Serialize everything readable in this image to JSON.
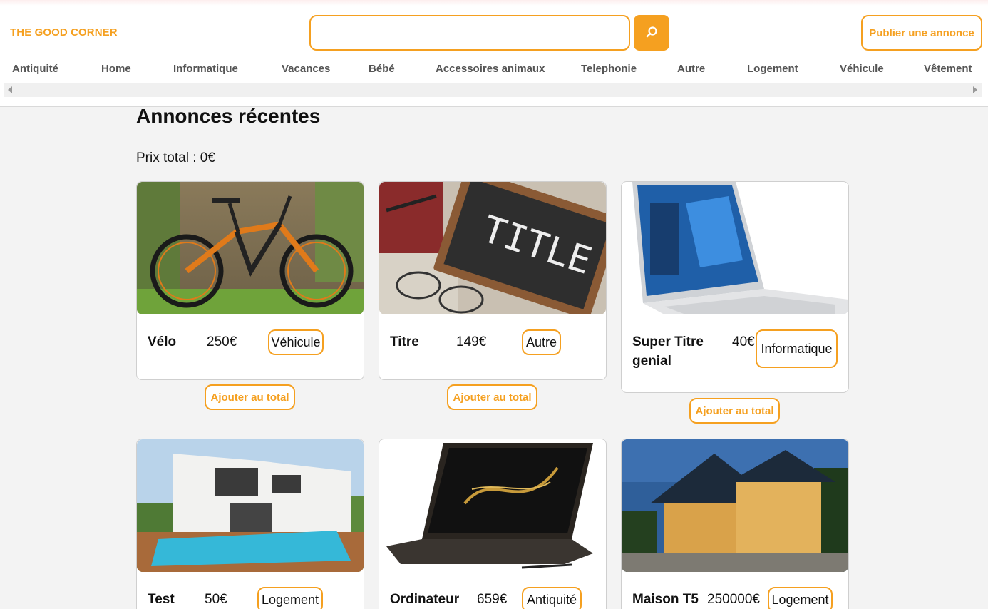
{
  "header": {
    "logo": "THE GOOD CORNER",
    "search_value": "",
    "search_placeholder": "",
    "publish_label": "Publier une annonce"
  },
  "nav": {
    "items": [
      "Antiquité",
      "Home",
      "Informatique",
      "Vacances",
      "Bébé",
      "Accessoires animaux",
      "Telephonie",
      "Autre",
      "Logement",
      "Véhicule",
      "Vêtement"
    ]
  },
  "main": {
    "title": "Annonces récentes",
    "total_label": "Prix total : ",
    "total_value": "0€",
    "add_label": "Ajouter au total",
    "ads": [
      {
        "name": "Vélo",
        "price": "250€",
        "category": "Véhicule"
      },
      {
        "name": "Titre",
        "price": "149€",
        "category": "Autre"
      },
      {
        "name": "Super Titre genial",
        "price": "40€",
        "category": "Informatique"
      },
      {
        "name": "Test",
        "price": "50€",
        "category": "Logement"
      },
      {
        "name": "Ordinateur",
        "price": "659€",
        "category": "Antiquité"
      },
      {
        "name": "Maison T5",
        "price": "250000€",
        "category": "Logement"
      }
    ]
  },
  "colors": {
    "accent": "#f5a020",
    "background": "#f3f3f3"
  },
  "icons": {
    "search": "search-icon"
  }
}
